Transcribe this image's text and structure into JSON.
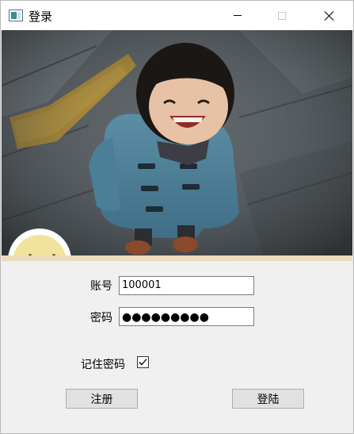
{
  "window": {
    "title": "登录"
  },
  "form": {
    "account_label": "账号",
    "account_value": "100001",
    "password_label": "密码",
    "password_mask": "●●●●●●●●●",
    "remember_label": "记住密码",
    "remember_checked": true
  },
  "buttons": {
    "register": "注册",
    "login": "登陆"
  },
  "icons": {
    "app": "app-window-icon",
    "minimize": "minimize-icon",
    "maximize": "maximize-icon",
    "close": "close-icon",
    "check": "checkmark-icon"
  }
}
